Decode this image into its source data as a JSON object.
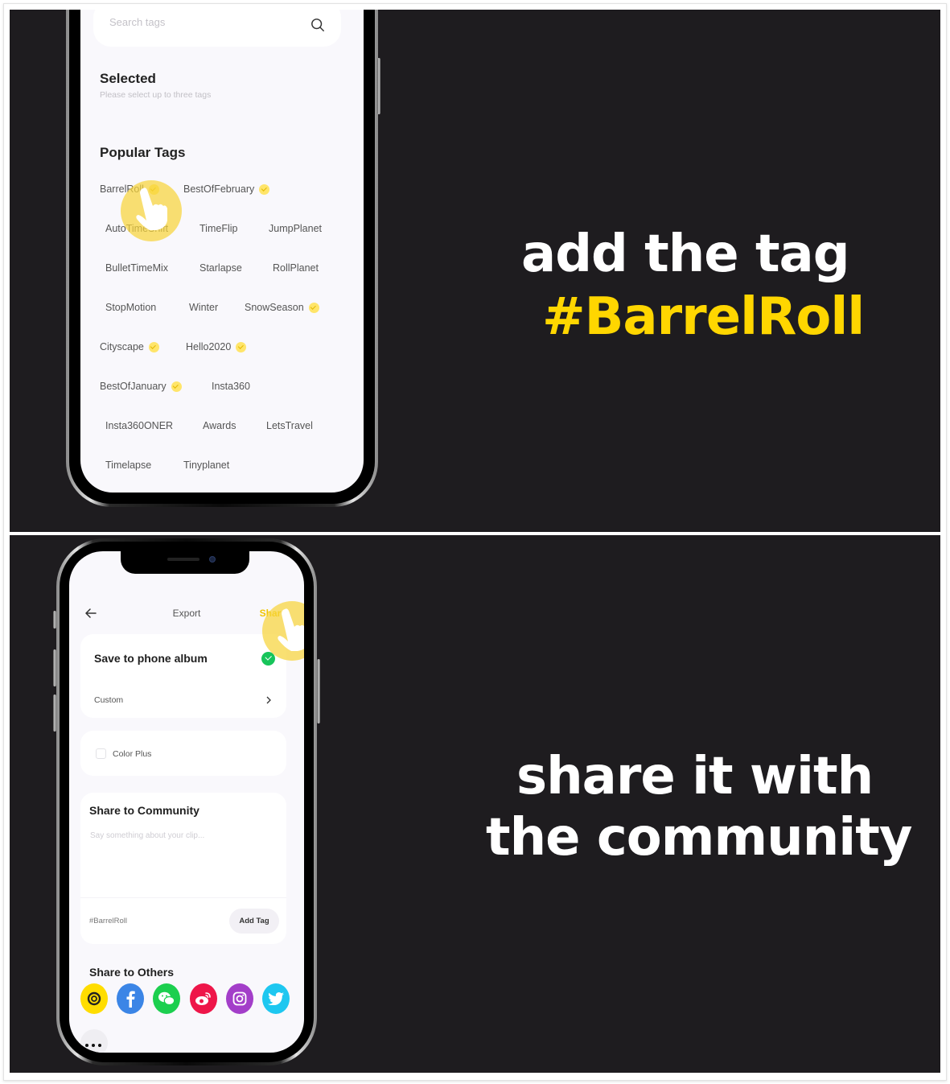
{
  "top_panel": {
    "search": {
      "placeholder": "Search tags",
      "icon": "search-icon"
    },
    "selected": {
      "title": "Selected",
      "subtitle": "Please select up to three tags"
    },
    "popular": {
      "title": "Popular Tags",
      "tags": [
        {
          "label": "BarrelRoll",
          "featured": true
        },
        {
          "label": "BestOfFebruary",
          "featured": true
        },
        {
          "label": "AutoTimeShift",
          "featured": false
        },
        {
          "label": "TimeFlip",
          "featured": false
        },
        {
          "label": "JumpPlanet",
          "featured": false
        },
        {
          "label": "BulletTimeMix",
          "featured": false
        },
        {
          "label": "Starlapse",
          "featured": false
        },
        {
          "label": "RollPlanet",
          "featured": false
        },
        {
          "label": "StopMotion",
          "featured": false
        },
        {
          "label": "Winter",
          "featured": false
        },
        {
          "label": "SnowSeason",
          "featured": true
        },
        {
          "label": "Cityscape",
          "featured": true
        },
        {
          "label": "Hello2020",
          "featured": true
        },
        {
          "label": "BestOfJanuary",
          "featured": true
        },
        {
          "label": "Insta360",
          "featured": false
        },
        {
          "label": "Insta360ONER",
          "featured": false
        },
        {
          "label": "Awards",
          "featured": false
        },
        {
          "label": "LetsTravel",
          "featured": false
        },
        {
          "label": "Timelapse",
          "featured": false
        },
        {
          "label": "Tinyplanet",
          "featured": false
        }
      ]
    },
    "caption": {
      "line1": "add the tag",
      "line2": "#BarrelRoll"
    }
  },
  "bottom_panel": {
    "nav": {
      "back_icon": "arrow-left-icon",
      "title": "Export",
      "action": "Share"
    },
    "save_card": {
      "title": "Save to phone album",
      "checked": true,
      "custom_label": "Custom"
    },
    "color_card": {
      "label": "Color Plus",
      "checked": false
    },
    "community_card": {
      "title": "Share to Community",
      "placeholder": "Say something about your clip...",
      "tag": "#BarrelRoll",
      "add_tag_label": "Add Tag"
    },
    "others": {
      "title": "Share to Others",
      "apps": [
        {
          "name": "insta360",
          "color": "#ffdd00"
        },
        {
          "name": "facebook",
          "color": "#3b85e6"
        },
        {
          "name": "wechat",
          "color": "#1ccf4f"
        },
        {
          "name": "weibo",
          "color": "#ee1649"
        },
        {
          "name": "instagram",
          "color": "#a33ec9"
        },
        {
          "name": "twitter",
          "color": "#1ec7f0"
        }
      ],
      "more_icon": "more-dots-icon"
    },
    "caption": {
      "line1": "share it with",
      "line2": "the community"
    }
  },
  "colors": {
    "accent_yellow": "#ffd600",
    "panel_bg": "#1e1c1f",
    "caption_white": "#ffffff"
  }
}
